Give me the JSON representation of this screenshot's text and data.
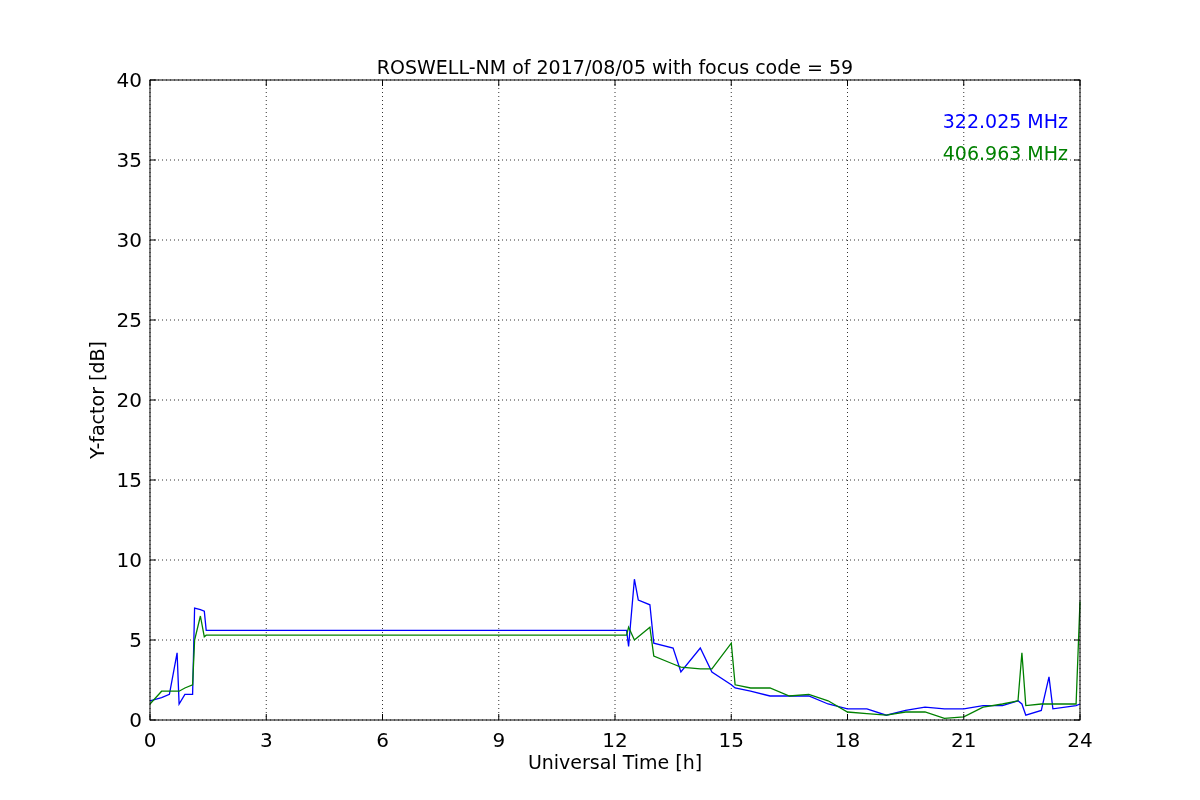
{
  "chart_data": {
    "type": "line",
    "title": "ROSWELL-NM of 2017/08/05 with focus code = 59",
    "xlabel": "Universal Time [h]",
    "ylabel": "Y-factor [dB]",
    "x": [
      0,
      0.3,
      0.5,
      0.7,
      0.75,
      0.9,
      1.1,
      1.15,
      1.3,
      1.4,
      1.45,
      12.3,
      12.35,
      12.5,
      12.6,
      12.9,
      13.0,
      13.5,
      13.7,
      14.2,
      14.5,
      15.0,
      15.1,
      15.5,
      16,
      16.5,
      17,
      17.5,
      18,
      18.5,
      19,
      19.5,
      20,
      20.5,
      21,
      21.5,
      22,
      22.4,
      22.5,
      22.6,
      23,
      23.2,
      23.3,
      23.9,
      24
    ],
    "series": [
      {
        "name": "322.025 MHz",
        "color": "#0000ff",
        "values": [
          1.2,
          1.4,
          1.6,
          4.2,
          1.0,
          1.6,
          1.6,
          7.0,
          6.9,
          6.8,
          5.6,
          5.6,
          4.6,
          8.8,
          7.5,
          7.2,
          4.8,
          4.5,
          3.0,
          4.5,
          3.0,
          2.2,
          2.0,
          1.8,
          1.5,
          1.5,
          1.5,
          1.0,
          0.7,
          0.7,
          0.3,
          0.6,
          0.8,
          0.7,
          0.7,
          0.9,
          0.9,
          1.2,
          1.0,
          0.3,
          0.6,
          2.7,
          0.7,
          0.9,
          1.0
        ]
      },
      {
        "name": "406.963 MHz",
        "color": "#008000",
        "values": [
          1.0,
          1.8,
          1.8,
          1.8,
          1.8,
          2.0,
          2.2,
          5.0,
          6.5,
          5.2,
          5.3,
          5.3,
          5.8,
          5.0,
          5.2,
          5.8,
          4.0,
          3.5,
          3.3,
          3.2,
          3.2,
          4.8,
          2.2,
          2.0,
          2.0,
          1.5,
          1.6,
          1.2,
          0.5,
          0.4,
          0.3,
          0.5,
          0.5,
          0.1,
          0.2,
          0.8,
          1.0,
          1.2,
          4.2,
          0.9,
          1.0,
          1.0,
          1.0,
          1.0,
          7.4
        ]
      }
    ],
    "xlim": [
      0,
      24
    ],
    "ylim": [
      0,
      40
    ],
    "xticks": [
      0,
      3,
      6,
      9,
      12,
      15,
      18,
      21,
      24
    ],
    "yticks": [
      0,
      5,
      10,
      15,
      20,
      25,
      30,
      35,
      40
    ],
    "grid": true
  }
}
